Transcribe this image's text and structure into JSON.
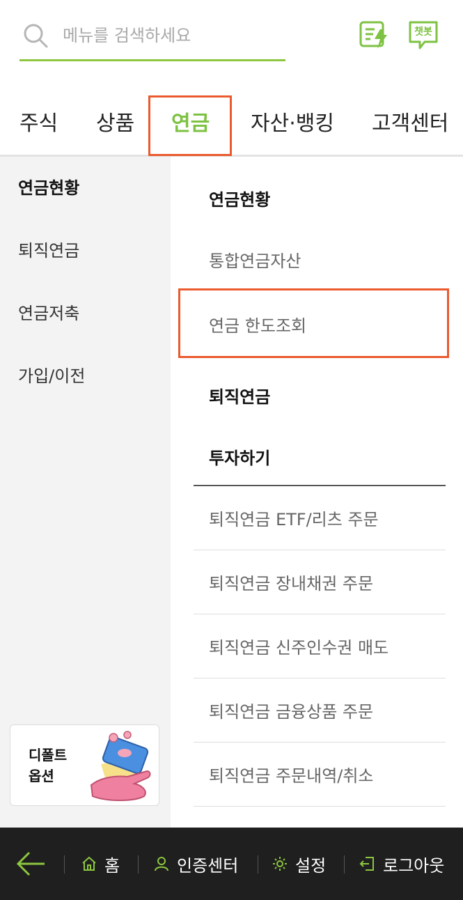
{
  "search": {
    "placeholder": "메뉴를 검색하세요"
  },
  "header_icons": {
    "quick": "quick-menu-icon",
    "chatbot": "chatbot-icon",
    "chatbot_label": "챗봇"
  },
  "tabs": [
    {
      "label": "주식"
    },
    {
      "label": "상품"
    },
    {
      "label": "연금",
      "active": true
    },
    {
      "label": "자산·뱅킹"
    },
    {
      "label": "고객센터"
    }
  ],
  "sidebar": {
    "items": [
      {
        "label": "연금현황",
        "active": true
      },
      {
        "label": "퇴직연금"
      },
      {
        "label": "연금저축"
      },
      {
        "label": "가입/이전"
      }
    ],
    "promo": {
      "line1": "디폴트",
      "line2": "옵션"
    }
  },
  "menu": {
    "section1": {
      "title": "연금현황",
      "items": [
        {
          "label": "통합연금자산"
        },
        {
          "label": "연금 한도조회"
        }
      ]
    },
    "section2": {
      "title": "퇴직연금"
    },
    "section3": {
      "title": "투자하기",
      "items": [
        {
          "label": "퇴직연금 ETF/리츠 주문"
        },
        {
          "label": "퇴직연금 장내채권 주문"
        },
        {
          "label": "퇴직연금 신주인수권 매도"
        },
        {
          "label": "퇴직연금 금융상품 주문"
        },
        {
          "label": "퇴직연금 주문내역/취소"
        }
      ]
    }
  },
  "bottom_bar": {
    "back_icon": "back-arrow-icon",
    "home": "홈",
    "auth": "인증센터",
    "settings": "설정",
    "logout": "로그아웃"
  },
  "colors": {
    "accent": "#7dc242",
    "highlight": "#ea5a2e",
    "bottom_bg": "#1f1f1f"
  }
}
